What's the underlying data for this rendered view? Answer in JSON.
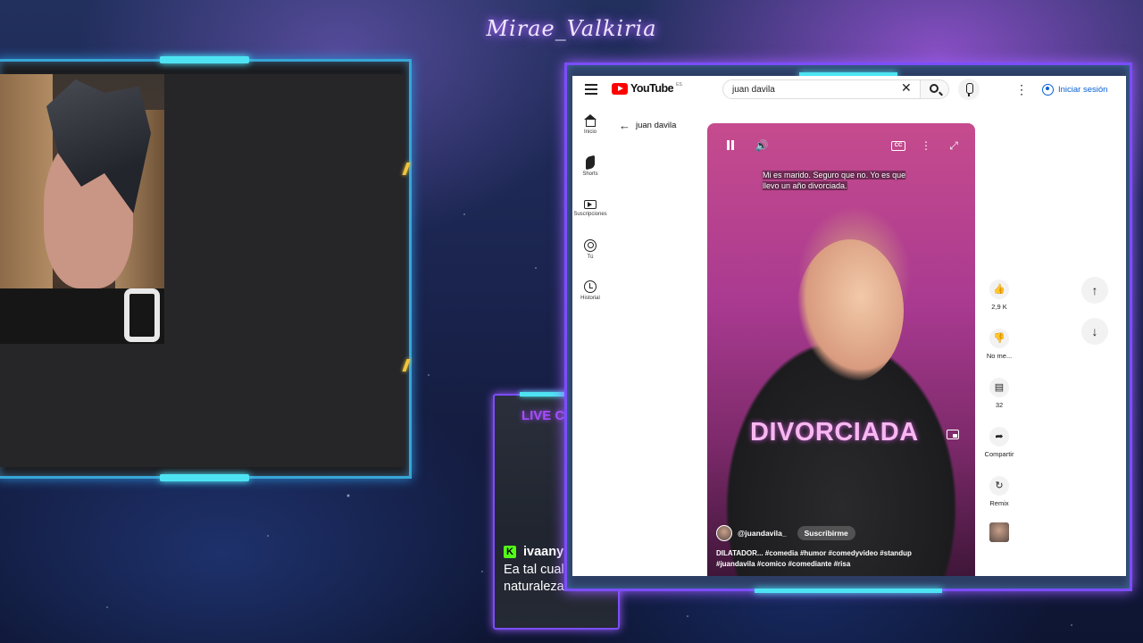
{
  "overlay": {
    "channel_name": "Mirae_Valkiria",
    "accent_cyan": "#4ee3f2",
    "accent_purple": "#7b4dff"
  },
  "chat": {
    "title": "LIVE CHAT",
    "messages": [
      {
        "platform_icon": "kick-icon",
        "user": "ivaanykoh",
        "text": "Ea tal cual naturaleza buena"
      }
    ]
  },
  "youtube": {
    "logo_text": "YouTube",
    "country_code": "ES",
    "search_value": "juan davila",
    "signin_label": "Iniciar sesión",
    "back_label": "juan davila",
    "sidebar": [
      {
        "icon": "home-icon",
        "label": "Inicio"
      },
      {
        "icon": "shorts-icon",
        "label": "Shorts"
      },
      {
        "icon": "subscriptions-icon",
        "label": "Suscripciones"
      },
      {
        "icon": "you-icon",
        "label": "Tú"
      },
      {
        "icon": "history-icon",
        "label": "Historial"
      }
    ],
    "short": {
      "subtitle_line1": "Mi es marido. Seguro que no. Yo es que",
      "subtitle_line2": "llevo un año divorciada.",
      "overlay_word": "DIVORCIADA",
      "channel": "@juandavila_",
      "subscribe_label": "Suscribirme",
      "description_line1": "DILATADOR... #comedia #humor #comedyvideo #standup",
      "description_line2": "#juandavila #comico #comediante #risa"
    },
    "actions": {
      "like_count": "2,9 K",
      "dislike_label": "No me...",
      "comments_count": "32",
      "share_label": "Compartir",
      "remix_label": "Remix"
    }
  }
}
